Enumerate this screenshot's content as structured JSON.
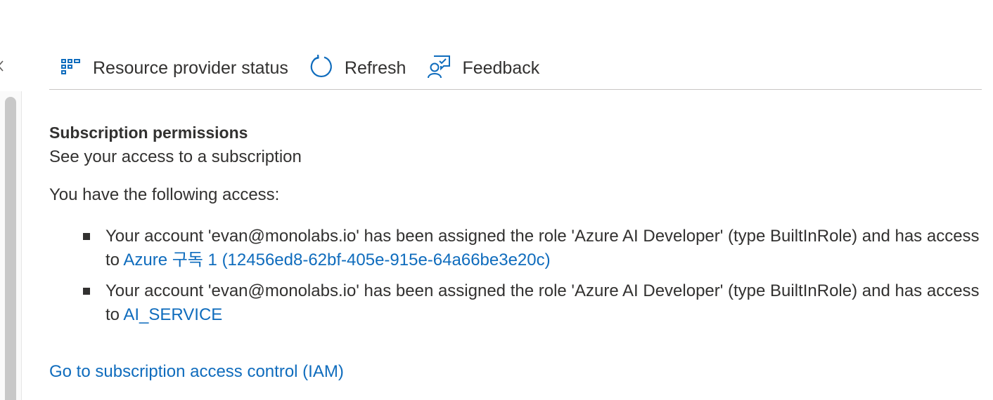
{
  "toolbar": {
    "resource_provider_status": {
      "label": "Resource provider status",
      "icon": "grid-icon"
    },
    "refresh": {
      "label": "Refresh",
      "icon": "refresh-icon"
    },
    "feedback": {
      "label": "Feedback",
      "icon": "feedback-icon"
    }
  },
  "section": {
    "title": "Subscription permissions",
    "subtitle": "See your access to a subscription",
    "intro": "You have the following access:"
  },
  "access_items": [
    {
      "text": "Your account 'evan@monolabs.io' has been assigned the role 'Azure AI Developer' (type BuiltInRole) and has access to ",
      "link": "Azure 구독 1 (12456ed8-62bf-405e-915e-64a66be3e20c)"
    },
    {
      "text": "Your account 'evan@monolabs.io' has been assigned the role 'Azure AI Developer' (type BuiltInRole) and has access to ",
      "link": "AI_SERVICE"
    }
  ],
  "iam_link": "Go to subscription access control (IAM)",
  "colors": {
    "accent": "#0f6cbd",
    "text": "#323130",
    "divider": "#c8c6c4"
  }
}
